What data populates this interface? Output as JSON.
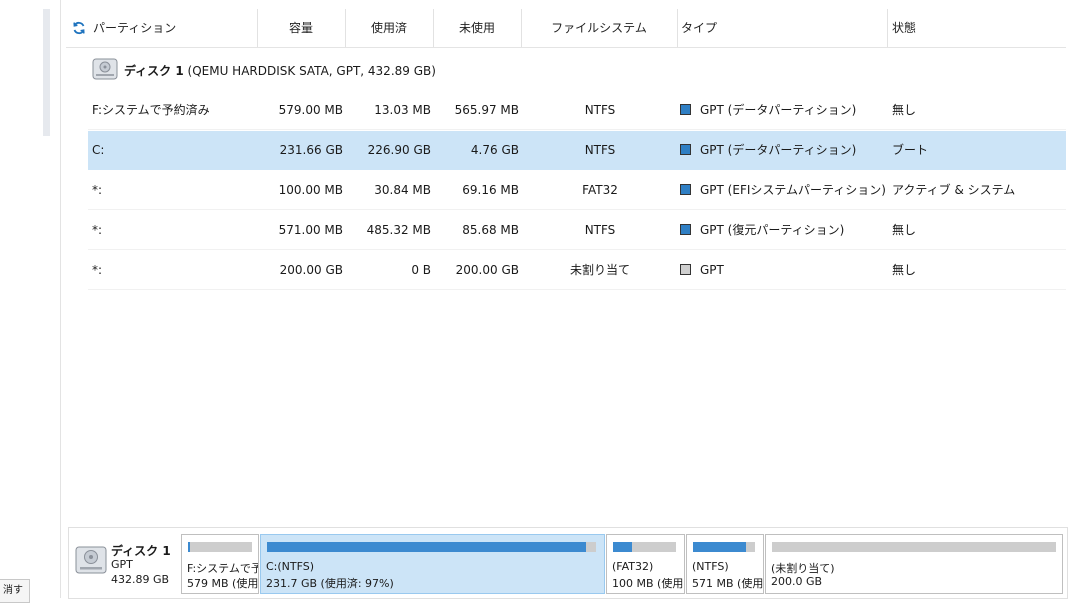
{
  "left_panel": {
    "button_label": "消す"
  },
  "columns": {
    "partition": "パーティション",
    "capacity": "容量",
    "used": "使用済",
    "unused": "未使用",
    "filesystem": "ファイルシステム",
    "type": "タイプ",
    "status": "状態"
  },
  "disk": {
    "name": "ディスク 1",
    "detail": " (QEMU HARDDISK SATA, GPT, 432.89 GB)"
  },
  "partitions": [
    {
      "name": "F:システムで予約済み",
      "capacity": "579.00 MB",
      "used": "13.03 MB",
      "unused": "565.97 MB",
      "fs": "NTFS",
      "type": "GPT (データパーティション)",
      "status": "無し",
      "swatch": "#2f7fc4"
    },
    {
      "name": "C:",
      "capacity": "231.66 GB",
      "used": "226.90 GB",
      "unused": "4.76 GB",
      "fs": "NTFS",
      "type": "GPT (データパーティション)",
      "status": "ブート",
      "swatch": "#2f7fc4"
    },
    {
      "name": "*:",
      "capacity": "100.00 MB",
      "used": "30.84 MB",
      "unused": "69.16 MB",
      "fs": "FAT32",
      "type": "GPT (EFIシステムパーティション)",
      "status": "アクティブ & システム",
      "swatch": "#2f7fc4"
    },
    {
      "name": "*:",
      "capacity": "571.00 MB",
      "used": "485.32 MB",
      "unused": "85.68 MB",
      "fs": "NTFS",
      "type": "GPT (復元パーティション)",
      "status": "無し",
      "swatch": "#2f7fc4"
    },
    {
      "name": "*:",
      "capacity": "200.00 GB",
      "used": "0 B",
      "unused": "200.00 GB",
      "fs": "未割り当て",
      "type": "GPT",
      "status": "無し",
      "swatch": "#cfcfcf"
    }
  ],
  "disk_map": {
    "name": "ディスク 1",
    "style": "GPT",
    "size": "432.89 GB",
    "blocks": [
      {
        "line1": "F:システムで予",
        "line2": "579 MB (使用",
        "fill": 0.02
      },
      {
        "line1": "C:(NTFS)",
        "line2": "231.7 GB (使用済: 97%)",
        "fill": 0.97
      },
      {
        "line1": "(FAT32)",
        "line2": "100 MB (使用",
        "fill": 0.3
      },
      {
        "line1": "(NTFS)",
        "line2": "571 MB (使用",
        "fill": 0.85
      },
      {
        "line1": "(未割り当て)",
        "line2": "200.0 GB",
        "fill": 0
      }
    ]
  },
  "colors": {
    "selected": "#cce4f7",
    "accent": "#3c8ad0"
  }
}
